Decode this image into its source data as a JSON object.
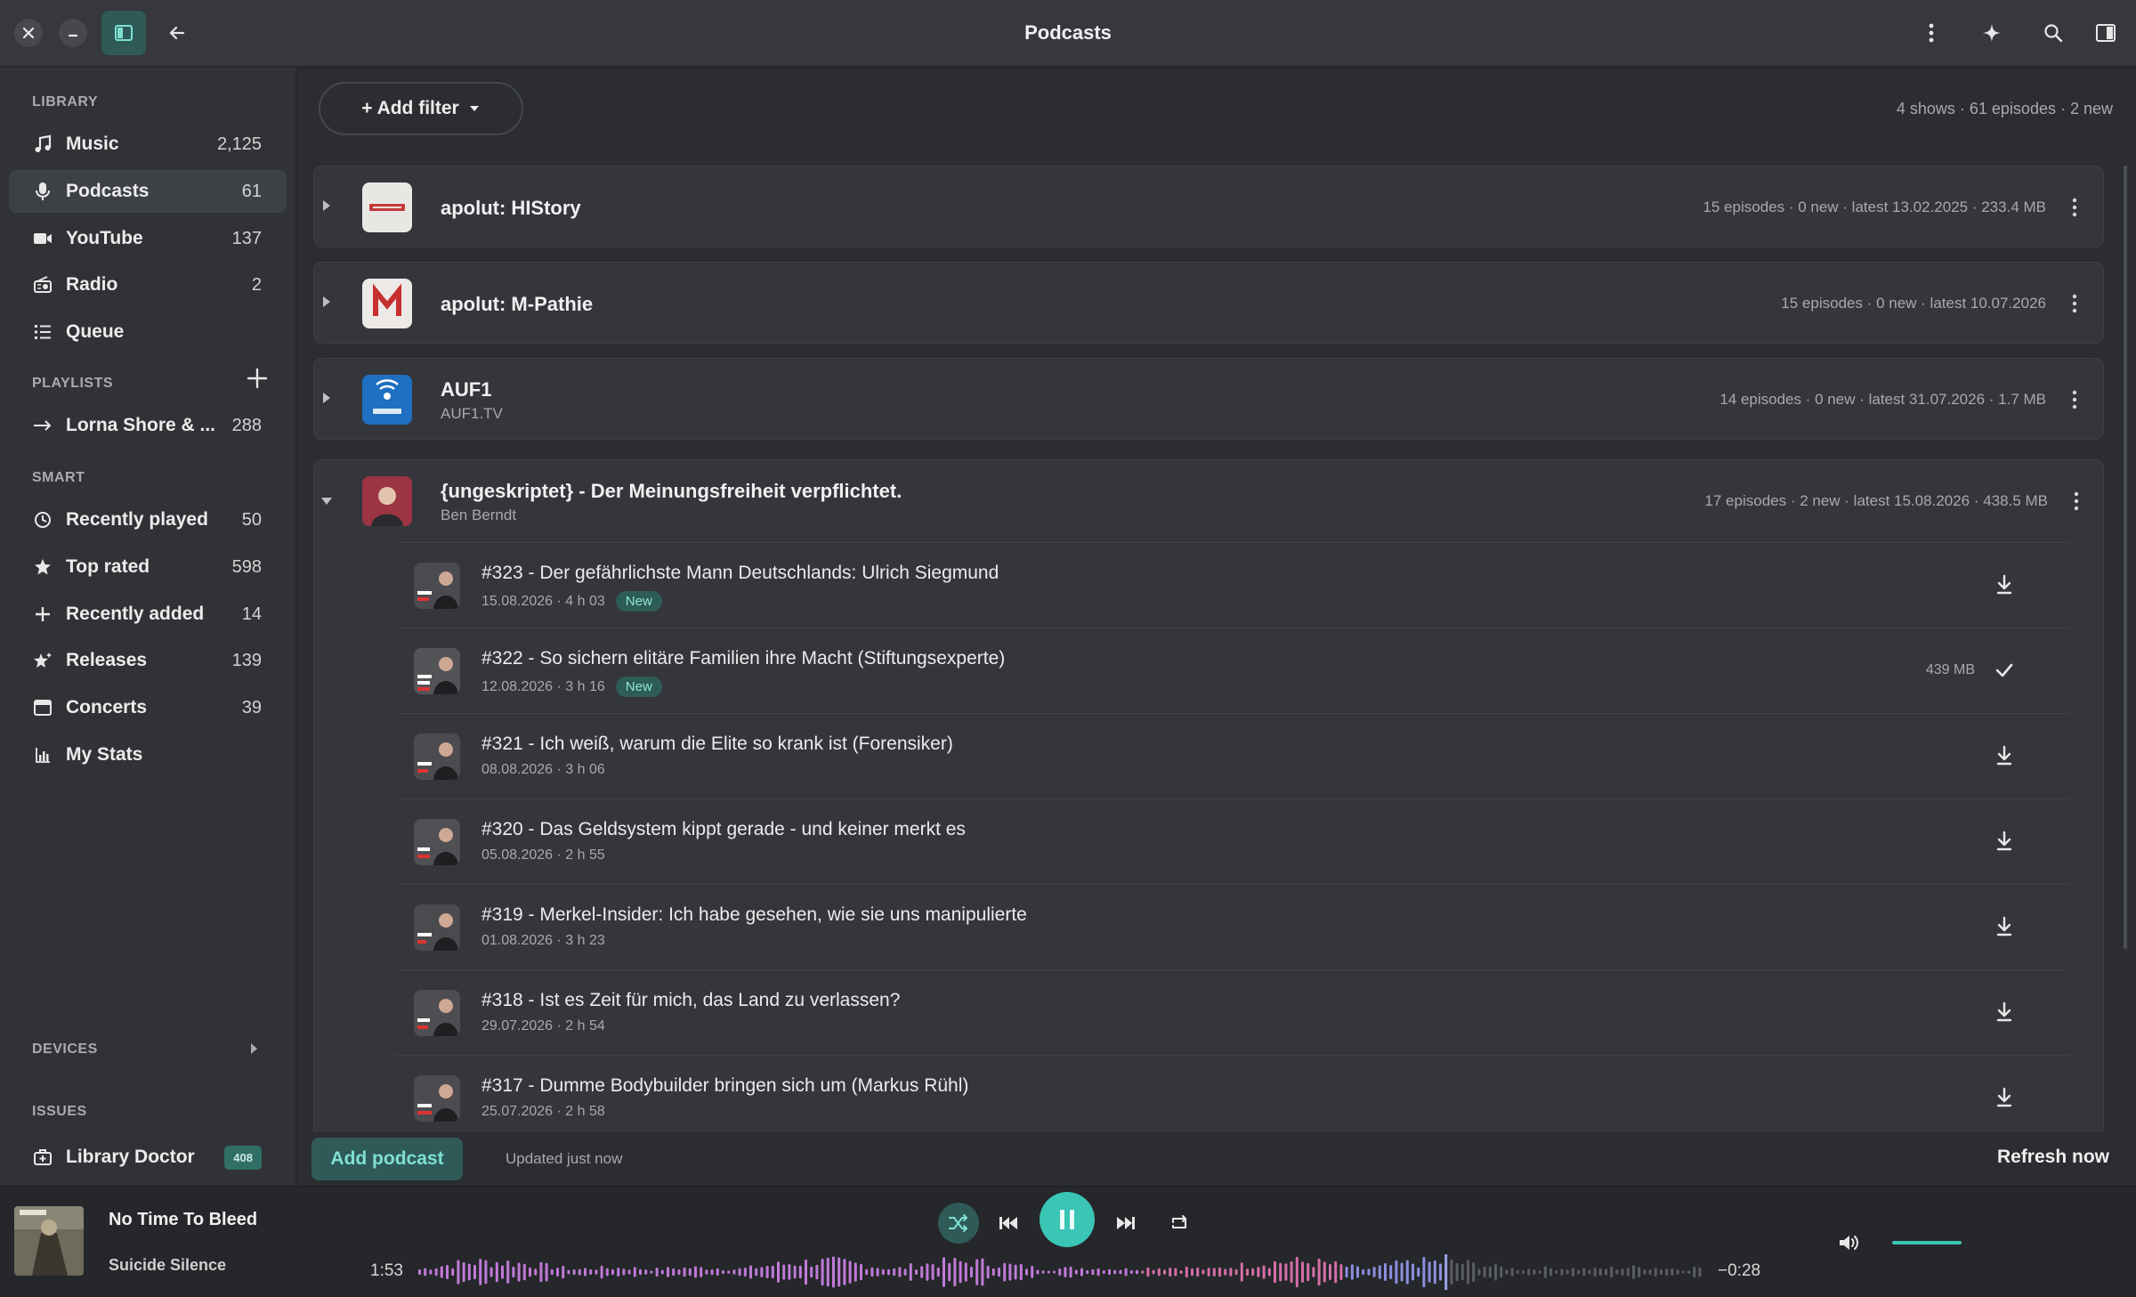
{
  "window": {
    "title": "Podcasts"
  },
  "sidebar": {
    "library_heading": "LIBRARY",
    "library": [
      {
        "label": "Music",
        "count": "2,125",
        "icon": "music-note-icon"
      },
      {
        "label": "Podcasts",
        "count": "61",
        "icon": "microphone-icon",
        "active": true
      },
      {
        "label": "YouTube",
        "count": "137",
        "icon": "video-camera-icon"
      },
      {
        "label": "Radio",
        "count": "2",
        "icon": "radio-icon"
      },
      {
        "label": "Queue",
        "count": "",
        "icon": "list-icon"
      }
    ],
    "playlists_heading": "PLAYLISTS",
    "playlists": [
      {
        "label": "Lorna Shore & ...",
        "count": "288",
        "icon": "arrow-right-icon"
      }
    ],
    "smart_heading": "SMART",
    "smart": [
      {
        "label": "Recently played",
        "count": "50",
        "icon": "clock-icon"
      },
      {
        "label": "Top rated",
        "count": "598",
        "icon": "star-icon"
      },
      {
        "label": "Recently added",
        "count": "14",
        "icon": "plus-icon"
      },
      {
        "label": "Releases",
        "count": "139",
        "icon": "star-sparkle-icon"
      },
      {
        "label": "Concerts",
        "count": "39",
        "icon": "window-icon"
      },
      {
        "label": "My Stats",
        "count": "",
        "icon": "bar-chart-icon"
      }
    ],
    "devices_heading": "DEVICES",
    "issues_heading": "ISSUES",
    "issues": [
      {
        "label": "Library Doctor",
        "count": "408",
        "icon": "medkit-icon"
      }
    ]
  },
  "toolbar": {
    "add_filter": "+ Add filter",
    "summary": "4 shows · 61 episodes · 2 new"
  },
  "shows": [
    {
      "title": "apolut: HIStory",
      "subtitle": "",
      "meta": "15 episodes · 0 new · latest 13.02.2025 · 233.4 MB"
    },
    {
      "title": "apolut: M-Pathie",
      "subtitle": "",
      "meta": "15 episodes · 0 new · latest 10.07.2026"
    },
    {
      "title": "AUF1",
      "subtitle": "AUF1.TV",
      "meta": "14 episodes · 0 new · latest 31.07.2026 · 1.7 MB"
    },
    {
      "title": "{ungeskriptet} - Der Meinungsfreiheit verpflichtet.",
      "subtitle": "Ben Berndt",
      "meta": "17 episodes · 2 new · latest 15.08.2026 · 438.5 MB"
    }
  ],
  "episodes": [
    {
      "title": "#323 - Der gefährlichste Mann Deutschlands: Ulrich Siegmund",
      "sub": "15.08.2026 · 4 h 03",
      "new": "New",
      "size": "",
      "action": "download-icon"
    },
    {
      "title": "#322 - So sichern elitäre Familien ihre Macht (Stiftungsexperte)",
      "sub": "12.08.2026 · 3 h 16",
      "new": "New",
      "size": "439 MB",
      "action": "check-icon"
    },
    {
      "title": "#321 - Ich weiß, warum die Elite so krank ist (Forensiker)",
      "sub": "08.08.2026 · 3 h 06",
      "new": "",
      "size": "",
      "action": "download-icon"
    },
    {
      "title": "#320 - Das Geldsystem kippt gerade - und keiner merkt es",
      "sub": "05.08.2026 · 2 h 55",
      "new": "",
      "size": "",
      "action": "download-icon"
    },
    {
      "title": "#319 - Merkel-Insider: Ich habe gesehen, wie sie uns manipulierte",
      "sub": "01.08.2026 · 3 h 23",
      "new": "",
      "size": "",
      "action": "download-icon"
    },
    {
      "title": "#318 - Ist es Zeit für mich, das Land zu verlassen?",
      "sub": "29.07.2026 · 2 h 54",
      "new": "",
      "size": "",
      "action": "download-icon"
    },
    {
      "title": "#317 - Dumme Bodybuilder bringen sich um (Markus Rühl)",
      "sub": "25.07.2026 · 2 h 58",
      "new": "",
      "size": "",
      "action": "download-icon"
    }
  ],
  "footer": {
    "add_podcast": "Add podcast",
    "updated": "Updated just now",
    "refresh": "Refresh now"
  },
  "player": {
    "track": "No Time To Bleed",
    "artist": "Suicide Silence",
    "elapsed": "1:53",
    "remaining": "−0:28",
    "progress": 0.8,
    "volume": 0.6
  },
  "colors": {
    "accent": "#3ac5b5",
    "background": "#2b2d31",
    "new_badge": "#2e5c57"
  }
}
